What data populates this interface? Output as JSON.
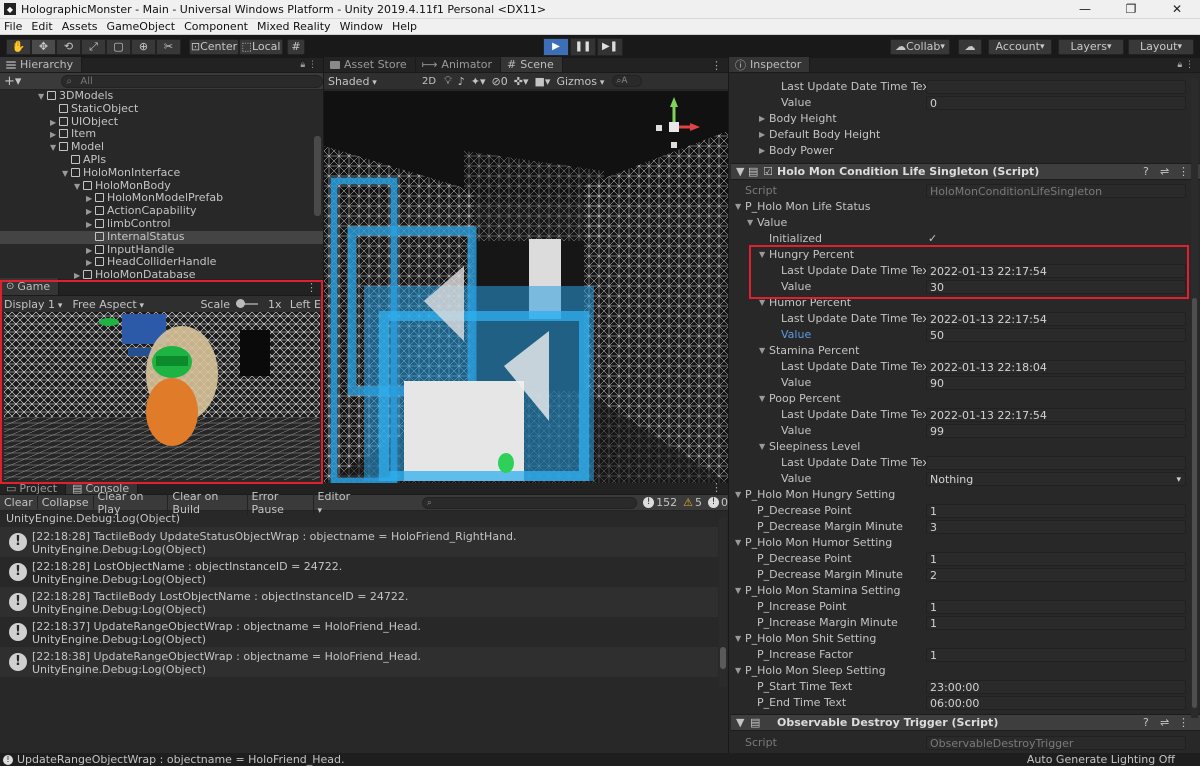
{
  "window": {
    "title": "HolographicMonster - Main - Universal Windows Platform - Unity 2019.4.11f1 Personal <DX11>",
    "minimize": "—",
    "maximize": "❐",
    "close": "✕"
  },
  "menu": [
    "File",
    "Edit",
    "Assets",
    "GameObject",
    "Component",
    "Mixed Reality",
    "Window",
    "Help"
  ],
  "toolbar": {
    "center": "Center",
    "local": "Local",
    "collab": "Collab",
    "account": "Account",
    "layers": "Layers",
    "layout": "Layout"
  },
  "hierarchy": {
    "tab": "Hierarchy",
    "search_placeholder": "All",
    "items": [
      {
        "label": "3DModels",
        "indent": 0,
        "arrow": "▼"
      },
      {
        "label": "StaticObject",
        "indent": 1,
        "arrow": ""
      },
      {
        "label": "UIObject",
        "indent": 1,
        "arrow": "▶"
      },
      {
        "label": "Item",
        "indent": 1,
        "arrow": "▶"
      },
      {
        "label": "Model",
        "indent": 1,
        "arrow": "▼"
      },
      {
        "label": "APIs",
        "indent": 2,
        "arrow": ""
      },
      {
        "label": "HoloMonInterface",
        "indent": 2,
        "arrow": "▼"
      },
      {
        "label": "HoloMonBody",
        "indent": 3,
        "arrow": "▼"
      },
      {
        "label": "HoloMonModelPrefab",
        "indent": 4,
        "arrow": "▶"
      },
      {
        "label": "ActionCapability",
        "indent": 4,
        "arrow": "▶"
      },
      {
        "label": "limbControl",
        "indent": 4,
        "arrow": "▶"
      },
      {
        "label": "InternalStatus",
        "indent": 4,
        "arrow": "",
        "sel": true
      },
      {
        "label": "InputHandle",
        "indent": 4,
        "arrow": "▶"
      },
      {
        "label": "HeadColliderHandle",
        "indent": 4,
        "arrow": "▶"
      },
      {
        "label": "HoloMonDatabase",
        "indent": 3,
        "arrow": "▶"
      }
    ]
  },
  "game": {
    "tab": "Game",
    "display": "Display 1",
    "aspect": "Free Aspect",
    "scale_label": "Scale",
    "scale_value": "1x",
    "left_eye": "Left E"
  },
  "scene": {
    "tabs": [
      "Asset Store",
      "Animator",
      "Scene"
    ],
    "shading": "Shaded",
    "mode2d": "2D",
    "audio_count": "0",
    "gizmos": "Gizmos",
    "search": "A"
  },
  "console": {
    "tabs": [
      "Project",
      "Console"
    ],
    "buttons": [
      "Clear",
      "Collapse",
      "Clear on Play",
      "Clear on Build",
      "Error Pause",
      "Editor"
    ],
    "counts": {
      "info": "152",
      "warn": "5",
      "error": "0"
    },
    "first_line": "UnityEngine.Debug:Log(Object)",
    "entries": [
      {
        "l1": "[22:18:28] TactileBody UpdateStatusObjectWrap : objectname = HoloFriend_RightHand.",
        "l2": "UnityEngine.Debug:Log(Object)"
      },
      {
        "l1": "[22:18:28] LostObjectName : objectInstanceID = 24722.",
        "l2": "UnityEngine.Debug:Log(Object)"
      },
      {
        "l1": "[22:18:28] TactileBody LostObjectName : objectInstanceID = 24722.",
        "l2": "UnityEngine.Debug:Log(Object)"
      },
      {
        "l1": "[22:18:37] UpdateRangeObjectWrap : objectname = HoloFriend_Head.",
        "l2": "UnityEngine.Debug:Log(Object)"
      },
      {
        "l1": "[22:18:38] UpdateRangeObjectWrap : objectname = HoloFriend_Head.",
        "l2": "UnityEngine.Debug:Log(Object)"
      }
    ]
  },
  "inspector": {
    "tab": "Inspector",
    "top_rows": [
      {
        "label": "Last Update Date Time Text",
        "value": ""
      },
      {
        "label": "Value",
        "value": "0"
      }
    ],
    "foldouts": [
      "Body Height",
      "Default Body Height",
      "Body Power"
    ],
    "component1": {
      "title": "Holo Mon Condition Life Singleton (Script)",
      "script_label": "Script",
      "script_value": "HoloMonConditionLifeSingleton"
    },
    "life_status": "P_Holo Mon Life Status",
    "value_label": "Value",
    "initialized": {
      "label": "Initialized",
      "value": "✓"
    },
    "hungry": {
      "label": "Hungry Percent",
      "time_label": "Last Update Date Time Text",
      "time": "2022-01-13 22:17:54",
      "value_label": "Value",
      "value": "30"
    },
    "humor": {
      "label": "Humor Percent",
      "time_label": "Last Update Date Time Text",
      "time": "2022-01-13 22:17:54",
      "value_label": "Value",
      "value": "50"
    },
    "stamina": {
      "label": "Stamina Percent",
      "time_label": "Last Update Date Time Text",
      "time": "2022-01-13 22:18:04",
      "value_label": "Value",
      "value": "90"
    },
    "poop": {
      "label": "Poop Percent",
      "time_label": "Last Update Date Time Text",
      "time": "2022-01-13 22:17:54",
      "value_label": "Value",
      "value": "99"
    },
    "sleepiness": {
      "label": "Sleepiness Level",
      "time_label": "Last Update Date Time Text",
      "time": "",
      "value_label": "Value",
      "value": "Nothing"
    },
    "hungry_setting": {
      "label": "P_Holo Mon Hungry Setting",
      "r1": "P_Decrease Point",
      "v1": "1",
      "r2": "P_Decrease Margin Minute",
      "v2": "3"
    },
    "humor_setting": {
      "label": "P_Holo Mon Humor Setting",
      "r1": "P_Decrease Point",
      "v1": "1",
      "r2": "P_Decrease Margin Minute",
      "v2": "2"
    },
    "stamina_setting": {
      "label": "P_Holo Mon Stamina Setting",
      "r1": "P_Increase Point",
      "v1": "1",
      "r2": "P_Increase Margin Minute",
      "v2": "1"
    },
    "shit_setting": {
      "label": "P_Holo Mon Shit Setting",
      "r1": "P_Increase Factor",
      "v1": "1"
    },
    "sleep_setting": {
      "label": "P_Holo Mon Sleep Setting",
      "r1": "P_Start Time Text",
      "v1": "23:00:00",
      "r2": "P_End Time Text",
      "v2": "06:00:00"
    },
    "component2": {
      "title": "Observable Destroy Trigger (Script)",
      "script_label": "Script",
      "script_value": "ObservableDestroyTrigger"
    }
  },
  "statusbar": {
    "message": "UpdateRangeObjectWrap : objectname = HoloFriend_Head.",
    "right": "Auto Generate Lighting Off"
  }
}
